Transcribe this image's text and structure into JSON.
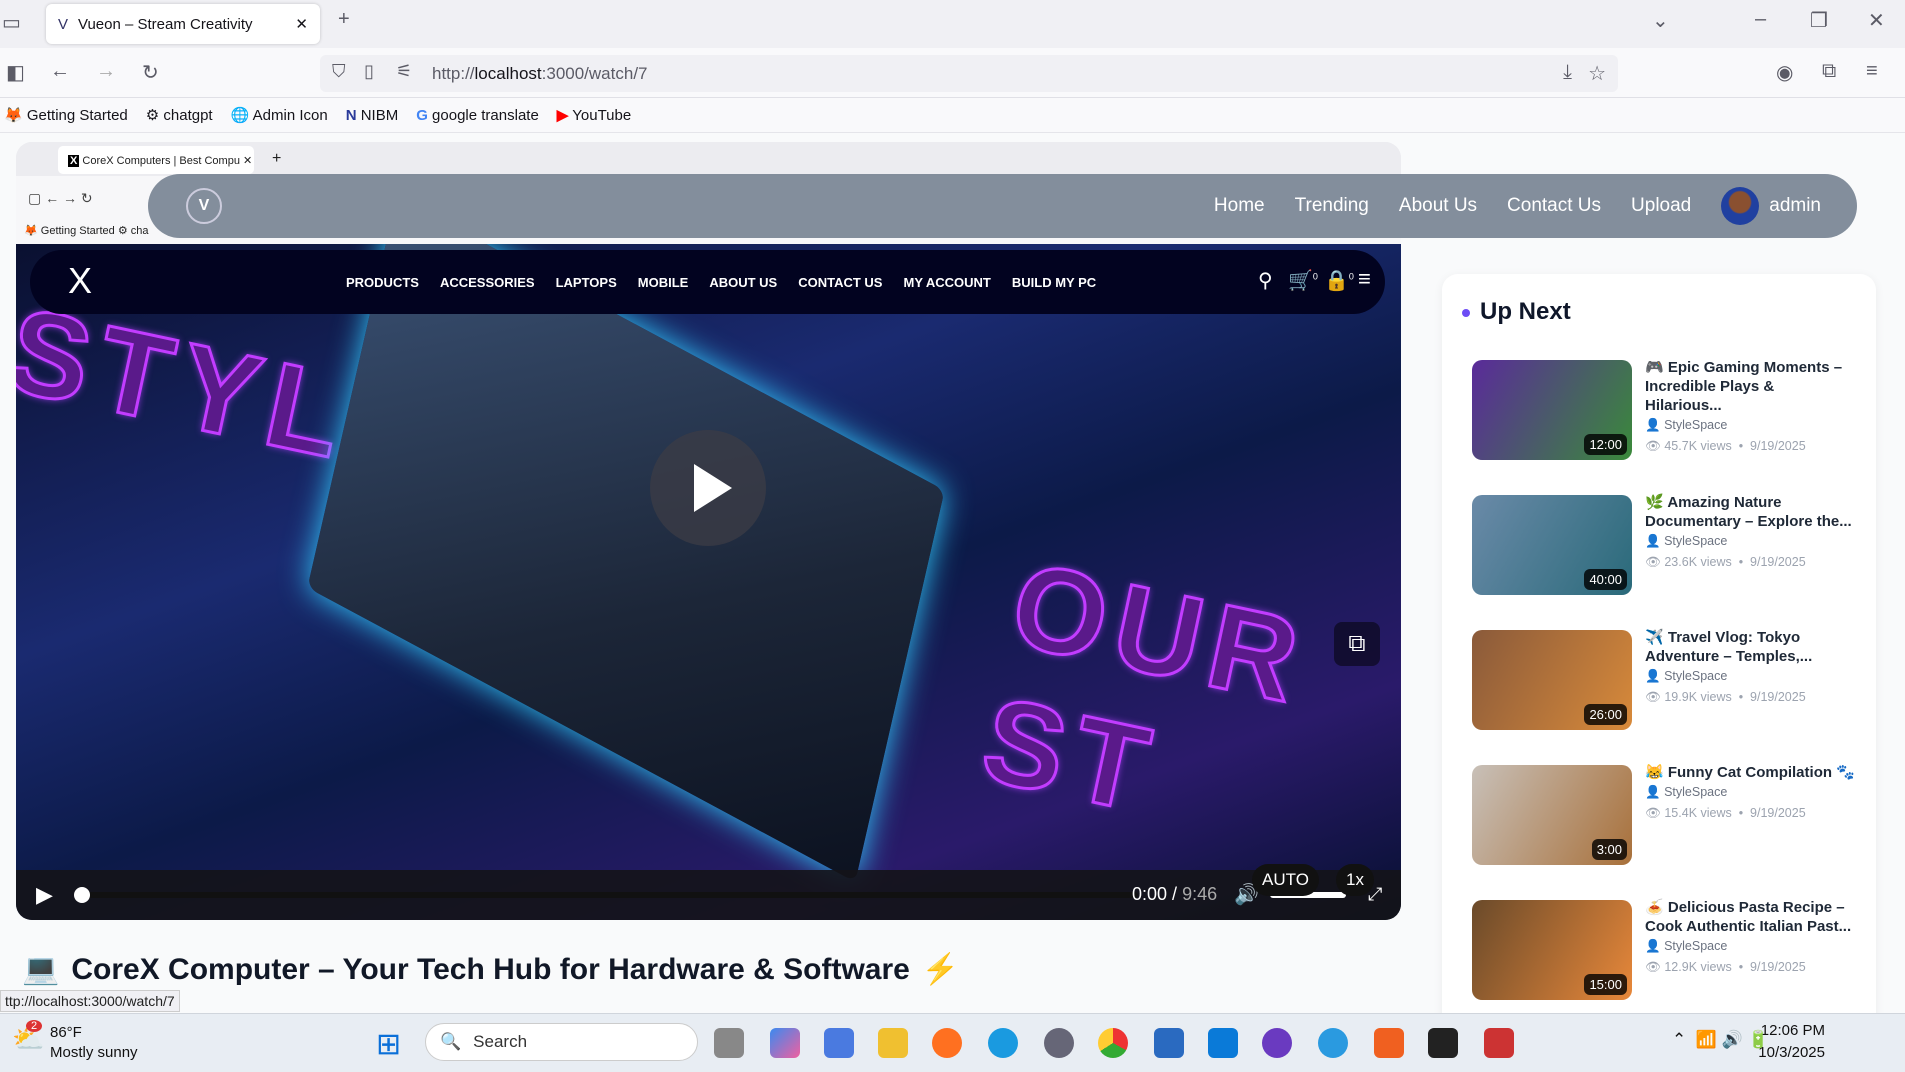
{
  "browser": {
    "tab_title": "Vueon – Stream Creativity",
    "url_prefix": "http://",
    "url_host": "localhost",
    "url_path": ":3000/watch/7",
    "bookmarks": [
      "Getting Started",
      "chatgpt",
      "Admin Icon",
      "NIBM",
      "google translate",
      "YouTube"
    ],
    "status_url": "ttp://localhost:3000/watch/7"
  },
  "inner_browser": {
    "tab_title": "CoreX Computers | Best Compu",
    "bookmark": "Getting Started",
    "bookmark2": "cha"
  },
  "site_nav": {
    "items": [
      "Home",
      "Trending",
      "About Us",
      "Contact Us",
      "Upload"
    ],
    "user": "admin"
  },
  "corex_nav": {
    "logo": "X",
    "links": [
      "PRODUCTS",
      "ACCESSORIES",
      "LAPTOPS",
      "MOBILE",
      "ABOUT US",
      "CONTACT US",
      "MY ACCOUNT",
      "BUILD MY PC"
    ],
    "cart_count": "0",
    "bag_count": "0"
  },
  "video": {
    "bg_text_1": "STYLE",
    "bg_text_2": "OUR ST",
    "current_time": "0:00",
    "duration": "9:46",
    "quality": "AUTO",
    "speed": "1x",
    "progress": 0
  },
  "video_title": {
    "emoji": "💻",
    "text": "CoreX Computer – Your Tech Hub for Hardware & Software",
    "emoji_end": "⚡"
  },
  "up_next": {
    "heading": "Up Next",
    "items": [
      {
        "emoji": "🎮",
        "title": "Epic Gaming Moments – Incredible Plays & Hilarious...",
        "channel": "StyleSpace",
        "views": "45.7K views",
        "date": "9/19/2025",
        "duration": "12:00",
        "colors": [
          "#5a2a9a",
          "#3a8a3a"
        ]
      },
      {
        "emoji": "🌿",
        "title": "Amazing Nature Documentary – Explore the...",
        "channel": "StyleSpace",
        "views": "23.6K views",
        "date": "9/19/2025",
        "duration": "40:00",
        "colors": [
          "#6a8aa8",
          "#2a6a7a"
        ]
      },
      {
        "emoji": "✈️",
        "title": "Travel Vlog: Tokyo Adventure – Temples,...",
        "channel": "StyleSpace",
        "views": "19.9K views",
        "date": "9/19/2025",
        "duration": "26:00",
        "colors": [
          "#8a5a3a",
          "#d88a3a"
        ]
      },
      {
        "emoji": "😹",
        "title": "Funny Cat Compilation 🐾",
        "channel": "StyleSpace",
        "views": "15.4K views",
        "date": "9/19/2025",
        "duration": "3:00",
        "colors": [
          "#c8c0b8",
          "#a8703a"
        ]
      },
      {
        "emoji": "🍝",
        "title": "Delicious Pasta Recipe – Cook Authentic Italian Past...",
        "channel": "StyleSpace",
        "views": "12.9K views",
        "date": "9/19/2025",
        "duration": "15:00",
        "colors": [
          "#6a4a2a",
          "#e8883a"
        ]
      }
    ]
  },
  "taskbar": {
    "weather_temp": "86°F",
    "weather_desc": "Mostly sunny",
    "weather_badge": "2",
    "search": "Search",
    "time": "12:06 PM",
    "date": "10/3/2025"
  }
}
